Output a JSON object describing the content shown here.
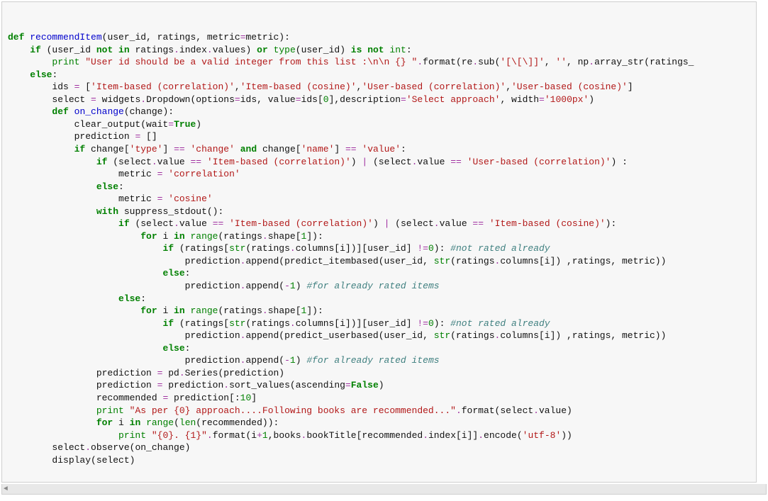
{
  "code": {
    "tokens": [
      [
        [
          "kdef",
          "def "
        ],
        [
          "fname",
          "recommendItem"
        ],
        [
          "plain",
          "(user_id, ratings, metric"
        ],
        [
          "op",
          "="
        ],
        [
          "plain",
          "metric):"
        ]
      ],
      [
        [
          "plain",
          "    "
        ],
        [
          "kflow",
          "if"
        ],
        [
          "plain",
          " (user_id "
        ],
        [
          "kflow",
          "not in"
        ],
        [
          "plain",
          " ratings"
        ],
        [
          "op",
          "."
        ],
        [
          "plain",
          "index"
        ],
        [
          "op",
          "."
        ],
        [
          "plain",
          "values) "
        ],
        [
          "kflow",
          "or"
        ],
        [
          "plain",
          " "
        ],
        [
          "builtin",
          "type"
        ],
        [
          "plain",
          "(user_id) "
        ],
        [
          "kflow",
          "is not"
        ],
        [
          "plain",
          " "
        ],
        [
          "builtin",
          "int"
        ],
        [
          "plain",
          ":"
        ]
      ],
      [
        [
          "plain",
          "        "
        ],
        [
          "kprint",
          "print"
        ],
        [
          "plain",
          " "
        ],
        [
          "str",
          "\"User id should be a valid integer from this list :\\n\\n {} \""
        ],
        [
          "op",
          "."
        ],
        [
          "plain",
          "format(re"
        ],
        [
          "op",
          "."
        ],
        [
          "plain",
          "sub("
        ],
        [
          "str",
          "'[\\[\\]]'"
        ],
        [
          "plain",
          ", "
        ],
        [
          "str",
          "''"
        ],
        [
          "plain",
          ", np"
        ],
        [
          "op",
          "."
        ],
        [
          "plain",
          "array_str(ratings_"
        ]
      ],
      [
        [
          "plain",
          "    "
        ],
        [
          "kflow",
          "else"
        ],
        [
          "plain",
          ":"
        ]
      ],
      [
        [
          "plain",
          "        ids "
        ],
        [
          "op",
          "="
        ],
        [
          "plain",
          " ["
        ],
        [
          "str",
          "'Item-based (correlation)'"
        ],
        [
          "plain",
          ","
        ],
        [
          "str",
          "'Item-based (cosine)'"
        ],
        [
          "plain",
          ","
        ],
        [
          "str",
          "'User-based (correlation)'"
        ],
        [
          "plain",
          ","
        ],
        [
          "str",
          "'User-based (cosine)'"
        ],
        [
          "plain",
          "]"
        ]
      ],
      [
        [
          "plain",
          "        select "
        ],
        [
          "op",
          "="
        ],
        [
          "plain",
          " widgets"
        ],
        [
          "op",
          "."
        ],
        [
          "plain",
          "Dropdown(options"
        ],
        [
          "op",
          "="
        ],
        [
          "plain",
          "ids, value"
        ],
        [
          "op",
          "="
        ],
        [
          "plain",
          "ids["
        ],
        [
          "num",
          "0"
        ],
        [
          "plain",
          "],description"
        ],
        [
          "op",
          "="
        ],
        [
          "str",
          "'Select approach'"
        ],
        [
          "plain",
          ", width"
        ],
        [
          "op",
          "="
        ],
        [
          "str",
          "'1000px'"
        ],
        [
          "plain",
          ")"
        ]
      ],
      [
        [
          "plain",
          "        "
        ],
        [
          "kdef",
          "def "
        ],
        [
          "fname",
          "on_change"
        ],
        [
          "plain",
          "(change):"
        ]
      ],
      [
        [
          "plain",
          "            clear_output(wait"
        ],
        [
          "op",
          "="
        ],
        [
          "kconst",
          "True"
        ],
        [
          "plain",
          ")"
        ]
      ],
      [
        [
          "plain",
          "            prediction "
        ],
        [
          "op",
          "="
        ],
        [
          "plain",
          " []"
        ]
      ],
      [
        [
          "plain",
          "            "
        ],
        [
          "kflow",
          "if"
        ],
        [
          "plain",
          " change["
        ],
        [
          "str",
          "'type'"
        ],
        [
          "plain",
          "] "
        ],
        [
          "op",
          "=="
        ],
        [
          "plain",
          " "
        ],
        [
          "str",
          "'change'"
        ],
        [
          "plain",
          " "
        ],
        [
          "kflow",
          "and"
        ],
        [
          "plain",
          " change["
        ],
        [
          "str",
          "'name'"
        ],
        [
          "plain",
          "] "
        ],
        [
          "op",
          "=="
        ],
        [
          "plain",
          " "
        ],
        [
          "str",
          "'value'"
        ],
        [
          "plain",
          ":"
        ]
      ],
      [
        [
          "plain",
          "                "
        ],
        [
          "kflow",
          "if"
        ],
        [
          "plain",
          " (select"
        ],
        [
          "op",
          "."
        ],
        [
          "plain",
          "value "
        ],
        [
          "op",
          "=="
        ],
        [
          "plain",
          " "
        ],
        [
          "str",
          "'Item-based (correlation)'"
        ],
        [
          "plain",
          ") "
        ],
        [
          "op",
          "|"
        ],
        [
          "plain",
          " (select"
        ],
        [
          "op",
          "."
        ],
        [
          "plain",
          "value "
        ],
        [
          "op",
          "=="
        ],
        [
          "plain",
          " "
        ],
        [
          "str",
          "'User-based (correlation)'"
        ],
        [
          "plain",
          ") :"
        ]
      ],
      [
        [
          "plain",
          "                    metric "
        ],
        [
          "op",
          "="
        ],
        [
          "plain",
          " "
        ],
        [
          "str",
          "'correlation'"
        ]
      ],
      [
        [
          "plain",
          "                "
        ],
        [
          "kflow",
          "else"
        ],
        [
          "plain",
          ":"
        ]
      ],
      [
        [
          "plain",
          "                    metric "
        ],
        [
          "op",
          "="
        ],
        [
          "plain",
          " "
        ],
        [
          "str",
          "'cosine'"
        ]
      ],
      [
        [
          "plain",
          "                "
        ],
        [
          "kflow",
          "with"
        ],
        [
          "plain",
          " suppress_stdout():"
        ]
      ],
      [
        [
          "plain",
          "                    "
        ],
        [
          "kflow",
          "if"
        ],
        [
          "plain",
          " (select"
        ],
        [
          "op",
          "."
        ],
        [
          "plain",
          "value "
        ],
        [
          "op",
          "=="
        ],
        [
          "plain",
          " "
        ],
        [
          "str",
          "'Item-based (correlation)'"
        ],
        [
          "plain",
          ") "
        ],
        [
          "op",
          "|"
        ],
        [
          "plain",
          " (select"
        ],
        [
          "op",
          "."
        ],
        [
          "plain",
          "value "
        ],
        [
          "op",
          "=="
        ],
        [
          "plain",
          " "
        ],
        [
          "str",
          "'Item-based (cosine)'"
        ],
        [
          "plain",
          "):"
        ]
      ],
      [
        [
          "plain",
          "                        "
        ],
        [
          "kflow",
          "for"
        ],
        [
          "plain",
          " i "
        ],
        [
          "kflow",
          "in"
        ],
        [
          "plain",
          " "
        ],
        [
          "builtin",
          "range"
        ],
        [
          "plain",
          "(ratings"
        ],
        [
          "op",
          "."
        ],
        [
          "plain",
          "shape["
        ],
        [
          "num",
          "1"
        ],
        [
          "plain",
          "]):"
        ]
      ],
      [
        [
          "plain",
          "                            "
        ],
        [
          "kflow",
          "if"
        ],
        [
          "plain",
          " (ratings["
        ],
        [
          "builtin",
          "str"
        ],
        [
          "plain",
          "(ratings"
        ],
        [
          "op",
          "."
        ],
        [
          "plain",
          "columns[i])][user_id] "
        ],
        [
          "op",
          "!="
        ],
        [
          "num",
          "0"
        ],
        [
          "plain",
          "): "
        ],
        [
          "comment",
          "#not rated already"
        ]
      ],
      [
        [
          "plain",
          "                                prediction"
        ],
        [
          "op",
          "."
        ],
        [
          "plain",
          "append(predict_itembased(user_id, "
        ],
        [
          "builtin",
          "str"
        ],
        [
          "plain",
          "(ratings"
        ],
        [
          "op",
          "."
        ],
        [
          "plain",
          "columns[i]) ,ratings, metric))"
        ]
      ],
      [
        [
          "plain",
          "                            "
        ],
        [
          "kflow",
          "else"
        ],
        [
          "plain",
          ":"
        ]
      ],
      [
        [
          "plain",
          "                                prediction"
        ],
        [
          "op",
          "."
        ],
        [
          "plain",
          "append("
        ],
        [
          "op",
          "-"
        ],
        [
          "num",
          "1"
        ],
        [
          "plain",
          ") "
        ],
        [
          "comment",
          "#for already rated items"
        ]
      ],
      [
        [
          "plain",
          "                    "
        ],
        [
          "kflow",
          "else"
        ],
        [
          "plain",
          ":"
        ]
      ],
      [
        [
          "plain",
          "                        "
        ],
        [
          "kflow",
          "for"
        ],
        [
          "plain",
          " i "
        ],
        [
          "kflow",
          "in"
        ],
        [
          "plain",
          " "
        ],
        [
          "builtin",
          "range"
        ],
        [
          "plain",
          "(ratings"
        ],
        [
          "op",
          "."
        ],
        [
          "plain",
          "shape["
        ],
        [
          "num",
          "1"
        ],
        [
          "plain",
          "]):"
        ]
      ],
      [
        [
          "plain",
          "                            "
        ],
        [
          "kflow",
          "if"
        ],
        [
          "plain",
          " (ratings["
        ],
        [
          "builtin",
          "str"
        ],
        [
          "plain",
          "(ratings"
        ],
        [
          "op",
          "."
        ],
        [
          "plain",
          "columns[i])][user_id] "
        ],
        [
          "op",
          "!="
        ],
        [
          "num",
          "0"
        ],
        [
          "plain",
          "): "
        ],
        [
          "comment",
          "#not rated already"
        ]
      ],
      [
        [
          "plain",
          "                                prediction"
        ],
        [
          "op",
          "."
        ],
        [
          "plain",
          "append(predict_userbased(user_id, "
        ],
        [
          "builtin",
          "str"
        ],
        [
          "plain",
          "(ratings"
        ],
        [
          "op",
          "."
        ],
        [
          "plain",
          "columns[i]) ,ratings, metric))"
        ]
      ],
      [
        [
          "plain",
          "                            "
        ],
        [
          "kflow",
          "else"
        ],
        [
          "plain",
          ":"
        ]
      ],
      [
        [
          "plain",
          "                                prediction"
        ],
        [
          "op",
          "."
        ],
        [
          "plain",
          "append("
        ],
        [
          "op",
          "-"
        ],
        [
          "num",
          "1"
        ],
        [
          "plain",
          ") "
        ],
        [
          "comment",
          "#for already rated items"
        ]
      ],
      [
        [
          "plain",
          "                prediction "
        ],
        [
          "op",
          "="
        ],
        [
          "plain",
          " pd"
        ],
        [
          "op",
          "."
        ],
        [
          "plain",
          "Series(prediction)"
        ]
      ],
      [
        [
          "plain",
          "                prediction "
        ],
        [
          "op",
          "="
        ],
        [
          "plain",
          " prediction"
        ],
        [
          "op",
          "."
        ],
        [
          "plain",
          "sort_values(ascending"
        ],
        [
          "op",
          "="
        ],
        [
          "kconst",
          "False"
        ],
        [
          "plain",
          ")"
        ]
      ],
      [
        [
          "plain",
          "                recommended "
        ],
        [
          "op",
          "="
        ],
        [
          "plain",
          " prediction[:"
        ],
        [
          "num",
          "10"
        ],
        [
          "plain",
          "]"
        ]
      ],
      [
        [
          "plain",
          "                "
        ],
        [
          "kprint",
          "print"
        ],
        [
          "plain",
          " "
        ],
        [
          "str",
          "\"As per {0} approach....Following books are recommended...\""
        ],
        [
          "op",
          "."
        ],
        [
          "plain",
          "format(select"
        ],
        [
          "op",
          "."
        ],
        [
          "plain",
          "value)"
        ]
      ],
      [
        [
          "plain",
          "                "
        ],
        [
          "kflow",
          "for"
        ],
        [
          "plain",
          " i "
        ],
        [
          "kflow",
          "in"
        ],
        [
          "plain",
          " "
        ],
        [
          "builtin",
          "range"
        ],
        [
          "plain",
          "("
        ],
        [
          "builtin",
          "len"
        ],
        [
          "plain",
          "(recommended)):"
        ]
      ],
      [
        [
          "plain",
          "                    "
        ],
        [
          "kprint",
          "print"
        ],
        [
          "plain",
          " "
        ],
        [
          "str",
          "\"{0}. {1}\""
        ],
        [
          "op",
          "."
        ],
        [
          "plain",
          "format(i"
        ],
        [
          "op",
          "+"
        ],
        [
          "num",
          "1"
        ],
        [
          "plain",
          ",books"
        ],
        [
          "op",
          "."
        ],
        [
          "plain",
          "bookTitle[recommended"
        ],
        [
          "op",
          "."
        ],
        [
          "plain",
          "index[i]]"
        ],
        [
          "op",
          "."
        ],
        [
          "plain",
          "encode("
        ],
        [
          "str",
          "'utf-8'"
        ],
        [
          "plain",
          "))"
        ]
      ],
      [
        [
          "plain",
          "        select"
        ],
        [
          "op",
          "."
        ],
        [
          "plain",
          "observe(on_change)"
        ]
      ],
      [
        [
          "plain",
          "        display(select)"
        ]
      ]
    ]
  }
}
